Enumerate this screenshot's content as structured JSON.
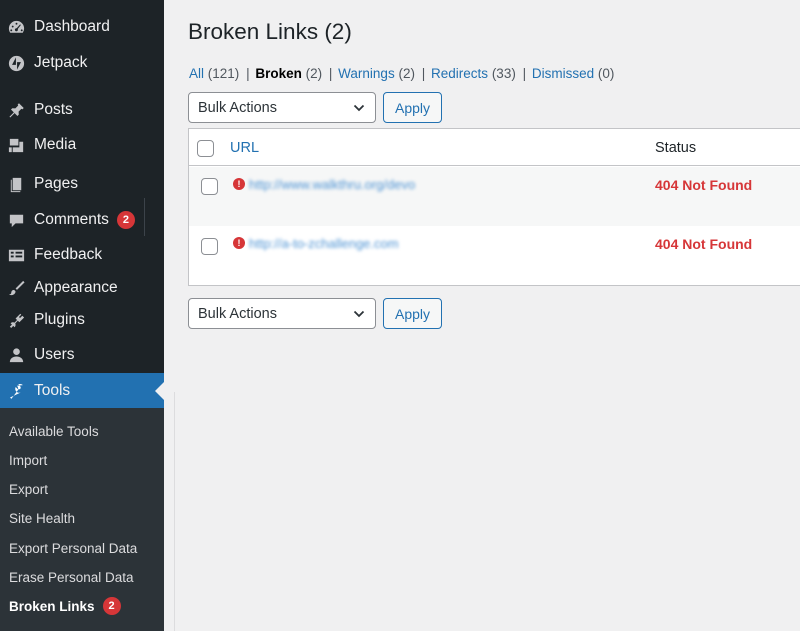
{
  "sidebar": {
    "items": [
      {
        "label": "Dashboard",
        "icon": "dashboard-icon"
      },
      {
        "label": "Jetpack",
        "icon": "jetpack-icon"
      },
      {
        "label": "Posts",
        "icon": "pin-icon"
      },
      {
        "label": "Media",
        "icon": "media-icon"
      },
      {
        "label": "Pages",
        "icon": "pages-icon"
      },
      {
        "label": "Comments",
        "icon": "comment-icon",
        "badge": "2"
      },
      {
        "label": "Feedback",
        "icon": "feedback-icon"
      },
      {
        "label": "Appearance",
        "icon": "brush-icon"
      },
      {
        "label": "Plugins",
        "icon": "plugin-icon"
      },
      {
        "label": "Users",
        "icon": "user-icon"
      },
      {
        "label": "Tools",
        "icon": "wrench-icon",
        "active": true
      }
    ],
    "submenu": [
      {
        "label": "Available Tools"
      },
      {
        "label": "Import"
      },
      {
        "label": "Export"
      },
      {
        "label": "Site Health"
      },
      {
        "label": "Export Personal Data"
      },
      {
        "label": "Erase Personal Data"
      },
      {
        "label": "Broken Links",
        "badge": "2",
        "current": true
      }
    ]
  },
  "page": {
    "title": "Broken Links (2)",
    "filters": [
      {
        "label": "All",
        "count": "(121)"
      },
      {
        "label": "Broken",
        "count": "(2)",
        "current": true
      },
      {
        "label": "Warnings",
        "count": "(2)"
      },
      {
        "label": "Redirects",
        "count": "(33)"
      },
      {
        "label": "Dismissed",
        "count": "(0)"
      }
    ],
    "separator": "|"
  },
  "bulk": {
    "label": "Bulk Actions",
    "apply_label": "Apply"
  },
  "table": {
    "columns": {
      "url": "URL",
      "status": "Status"
    },
    "rows": [
      {
        "url": "http://www.walkthru.org/devo",
        "status": "404 Not Found"
      },
      {
        "url": "http://a-to-zchallenge.com",
        "status": "404 Not Found"
      }
    ]
  },
  "colors": {
    "accent": "#2271b1",
    "error": "#d63638",
    "sidebar": "#1d2327"
  }
}
